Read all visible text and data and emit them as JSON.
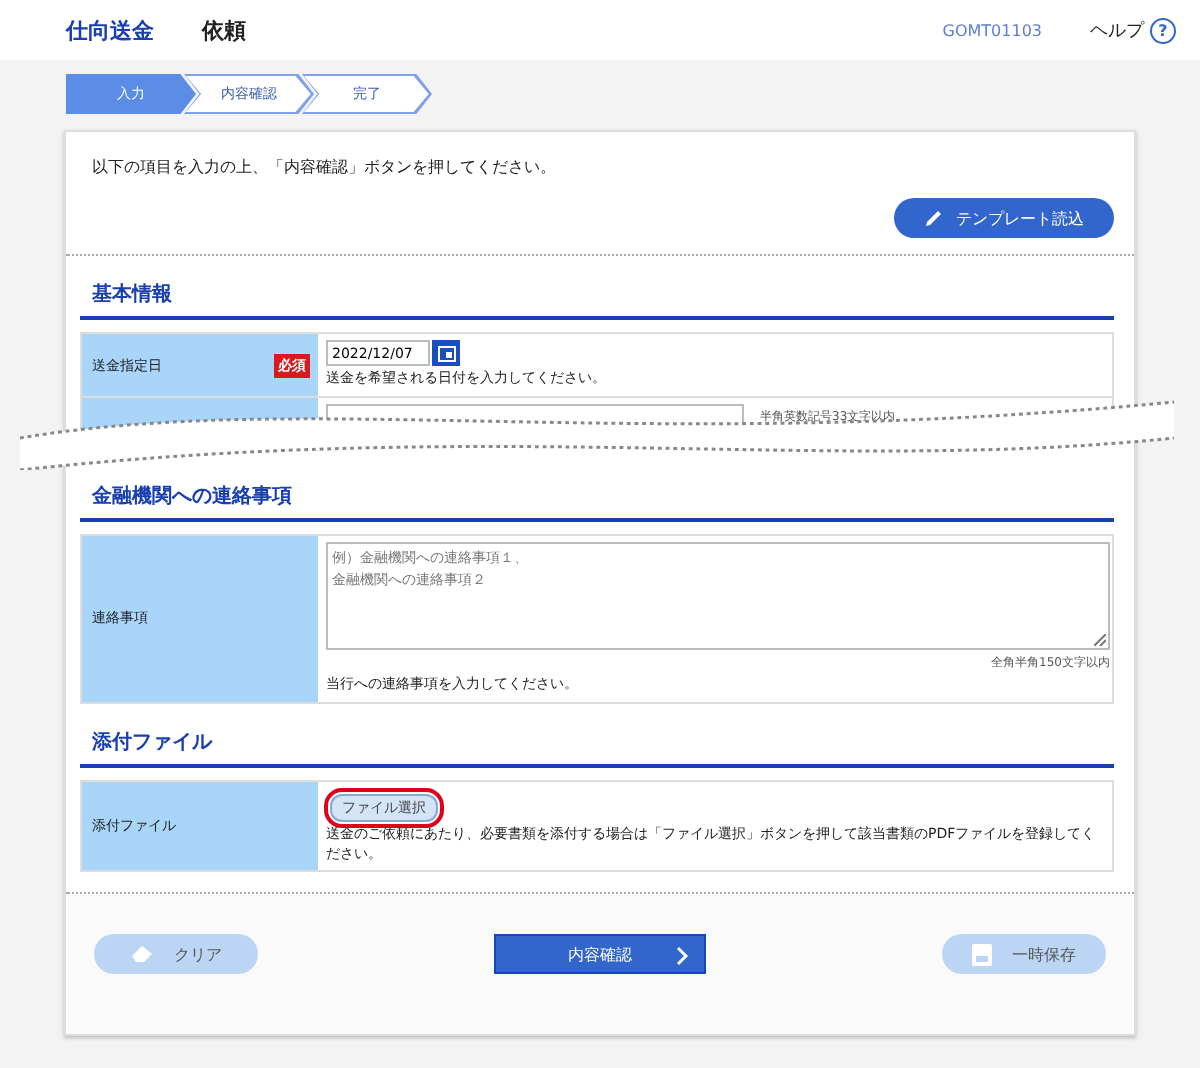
{
  "header": {
    "title": "仕向送金",
    "subtitle": "依頼",
    "screen_id": "GOMT01103",
    "help": "ヘルプ",
    "help_mark": "?"
  },
  "steps": [
    {
      "label": "入力",
      "selected": true
    },
    {
      "label": "内容確認",
      "selected": false
    },
    {
      "label": "完了",
      "selected": false
    }
  ],
  "intro": "以下の項目を入力の上、「内容確認」ボタンを押してください。",
  "template_button": "テンプレート読込",
  "basic": {
    "title": "基本情報",
    "date_label": "送金指定日",
    "required": "必須",
    "date_value": "2022/12/07",
    "date_hint": "送金を希望される日付を入力してください。",
    "ref_note": "半角英数記号33文字以内"
  },
  "contact": {
    "title": "金融機関への連絡事項",
    "label": "連絡事項",
    "placeholder": [
      "例）金融機関への連絡事項１、",
      "金融機関への連絡事項２"
    ],
    "limit": "全角半角150文字以内",
    "hint": "当行への連絡事項を入力してください。"
  },
  "attachment": {
    "title": "添付ファイル",
    "label": "添付ファイル",
    "button": "ファイル選択",
    "highlighted": true,
    "hint": "送金のご依頼にあたり、必要書類を添付する場合は「ファイル選択」ボタンを押して該当書類のPDFファイルを登録してください。"
  },
  "footer": {
    "clear": "クリア",
    "confirm": "内容確認",
    "save": "一時保存",
    "clear_disabled": true,
    "save_disabled": true
  }
}
